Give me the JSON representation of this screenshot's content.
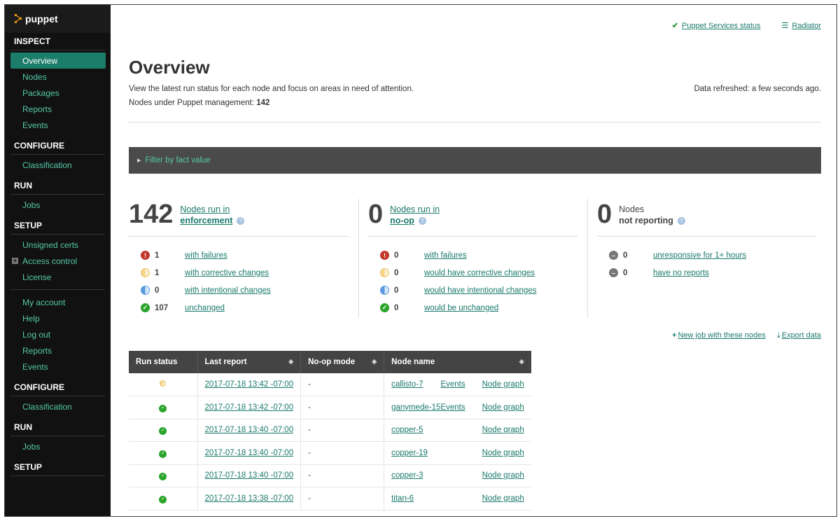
{
  "brand": "puppet",
  "sidebar": {
    "sections": [
      {
        "title": "INSPECT",
        "items": [
          "Overview",
          "Nodes",
          "Packages",
          "Reports",
          "Events"
        ],
        "active": "Overview"
      },
      {
        "title": "CONFIGURE",
        "items": [
          "Classification"
        ]
      },
      {
        "title": "RUN",
        "items": [
          "Jobs"
        ]
      },
      {
        "title": "SETUP",
        "items": [
          "Unsigned certs",
          "Access control",
          "License"
        ]
      }
    ],
    "account_items": [
      "My account",
      "Help",
      "Log out",
      "Reports",
      "Events"
    ],
    "sections2": [
      {
        "title": "CONFIGURE",
        "items": [
          "Classification"
        ]
      },
      {
        "title": "RUN",
        "items": [
          "Jobs"
        ]
      },
      {
        "title": "SETUP",
        "items": []
      }
    ]
  },
  "top_links": {
    "services_status": "Puppet Services status",
    "radiator": "Radiator"
  },
  "page": {
    "title": "Overview",
    "intro": "View the latest run status for each node and focus on areas in need of attention.",
    "mgmt_label": "Nodes under Puppet management: ",
    "mgmt_count": "142",
    "refreshed": "Data refreshed: a few seconds ago.",
    "filter_label": "Filter by fact value"
  },
  "panels": {
    "enforcement": {
      "count": "142",
      "line1": "Nodes run in",
      "line2": "enforcement",
      "rows": [
        {
          "icon": "fail",
          "count": "1",
          "label": "with failures"
        },
        {
          "icon": "corrective",
          "count": "1",
          "label": "with corrective changes"
        },
        {
          "icon": "intentional",
          "count": "0",
          "label": "with intentional changes"
        },
        {
          "icon": "ok",
          "count": "107",
          "label": "unchanged"
        }
      ]
    },
    "noop": {
      "count": "0",
      "line1": "Nodes run in",
      "line2": "no-op",
      "rows": [
        {
          "icon": "fail",
          "count": "0",
          "label": "with failures"
        },
        {
          "icon": "corrective",
          "count": "0",
          "label": "would have corrective changes"
        },
        {
          "icon": "intentional",
          "count": "0",
          "label": "would have intentional changes"
        },
        {
          "icon": "ok",
          "count": "0",
          "label": "would be unchanged"
        }
      ]
    },
    "not_reporting": {
      "count": "0",
      "line1": "Nodes",
      "line2": "not reporting",
      "rows": [
        {
          "icon": "noreport",
          "count": "0",
          "label": "unresponsive for 1+ hours"
        },
        {
          "icon": "noreport",
          "count": "0",
          "label": "have no reports"
        }
      ]
    }
  },
  "actions": {
    "new_job": "New job with these nodes",
    "export": "Export data"
  },
  "table": {
    "headers": [
      "Run status",
      "Last report",
      "No-op mode",
      "Node name"
    ],
    "events_label": "Events",
    "graph_label": "Node graph",
    "rows": [
      {
        "status": "corrective",
        "report": "2017-07-18 13:42 -07:00",
        "noop": "-",
        "node": "callisto-7",
        "events": true
      },
      {
        "status": "ok",
        "report": "2017-07-18 13:42 -07:00",
        "noop": "-",
        "node": "ganymede-15",
        "events": true
      },
      {
        "status": "ok",
        "report": "2017-07-18 13:40 -07:00",
        "noop": "-",
        "node": "copper-5",
        "events": false
      },
      {
        "status": "ok",
        "report": "2017-07-18 13:40 -07:00",
        "noop": "-",
        "node": "copper-19",
        "events": false
      },
      {
        "status": "ok",
        "report": "2017-07-18 13:40 -07:00",
        "noop": "-",
        "node": "copper-3",
        "events": false
      },
      {
        "status": "ok",
        "report": "2017-07-18 13:38 -07:00",
        "noop": "-",
        "node": "titan-6",
        "events": false
      }
    ]
  }
}
